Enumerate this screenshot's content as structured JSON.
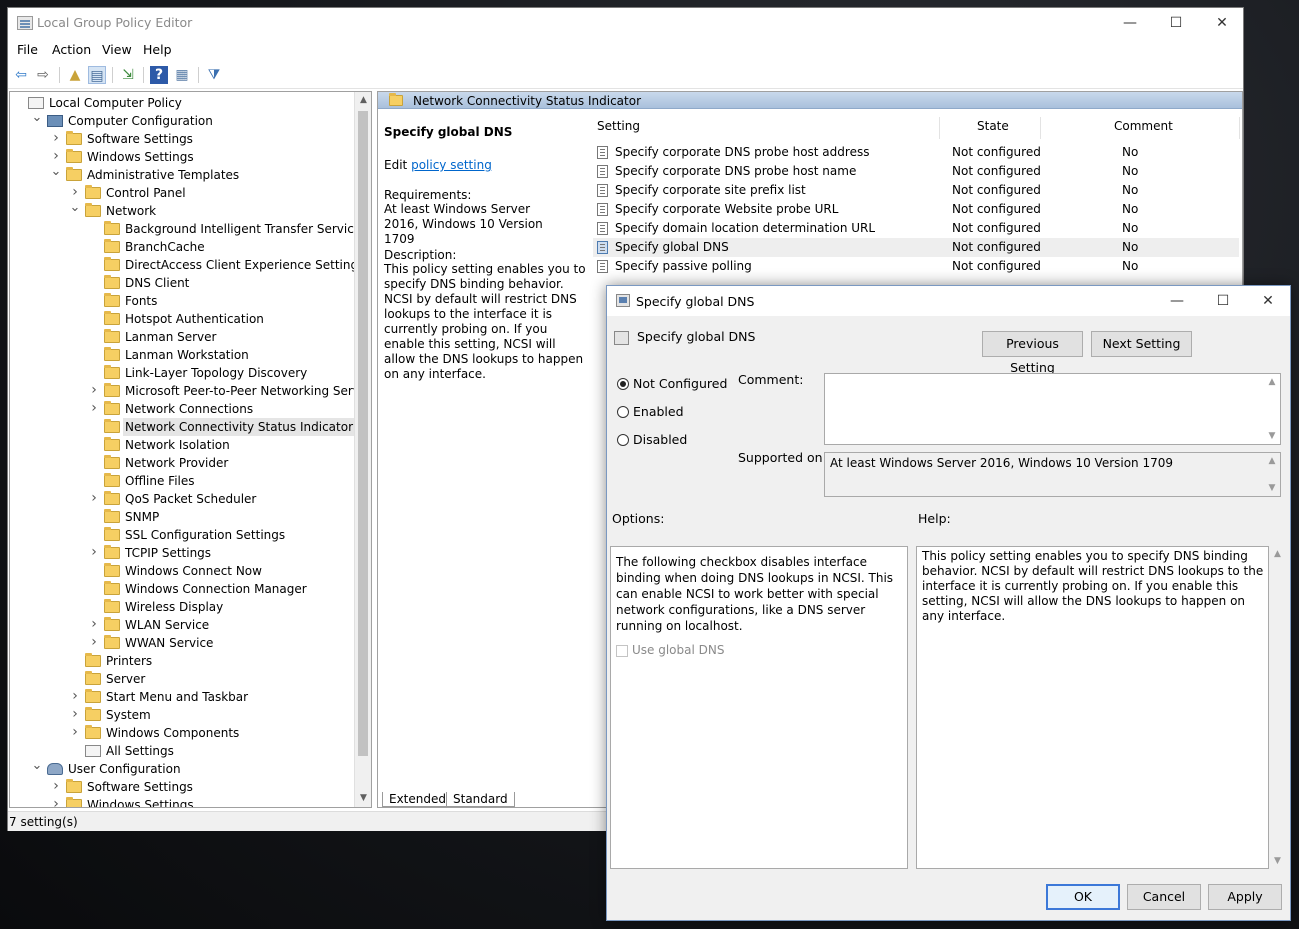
{
  "main_window": {
    "title": "Local Group Policy Editor",
    "min_glyph": "—",
    "max_glyph": "☐",
    "close_glyph": "✕"
  },
  "menu": [
    "File",
    "Action",
    "View",
    "Help"
  ],
  "toolbar": {
    "icons": [
      "back-icon",
      "forward-icon",
      "up-folder-icon",
      "show-hide-tree-icon",
      "export-list-icon",
      "help-icon",
      "properties-icon",
      "filter-icon"
    ],
    "glyphs": [
      "⇦",
      "⇨",
      "▲",
      "▤",
      "⇲",
      "?",
      "▦",
      "⧩"
    ]
  },
  "tree": [
    {
      "label": "Local Computer Policy",
      "level": 0,
      "exp": "",
      "icon": "doc"
    },
    {
      "label": "Computer Configuration",
      "level": 1,
      "exp": "v",
      "icon": "computer"
    },
    {
      "label": "Software Settings",
      "level": 2,
      "exp": ">",
      "icon": "folder"
    },
    {
      "label": "Windows Settings",
      "level": 2,
      "exp": ">",
      "icon": "folder"
    },
    {
      "label": "Administrative Templates",
      "level": 2,
      "exp": "v",
      "icon": "folder"
    },
    {
      "label": "Control Panel",
      "level": 3,
      "exp": ">",
      "icon": "folder"
    },
    {
      "label": "Network",
      "level": 3,
      "exp": "v",
      "icon": "folder"
    },
    {
      "label": "Background Intelligent Transfer Service (BITS)",
      "level": 4,
      "exp": "",
      "icon": "folder"
    },
    {
      "label": "BranchCache",
      "level": 4,
      "exp": "",
      "icon": "folder"
    },
    {
      "label": "DirectAccess Client Experience Settings",
      "level": 4,
      "exp": "",
      "icon": "folder"
    },
    {
      "label": "DNS Client",
      "level": 4,
      "exp": "",
      "icon": "folder"
    },
    {
      "label": "Fonts",
      "level": 4,
      "exp": "",
      "icon": "folder"
    },
    {
      "label": "Hotspot Authentication",
      "level": 4,
      "exp": "",
      "icon": "folder"
    },
    {
      "label": "Lanman Server",
      "level": 4,
      "exp": "",
      "icon": "folder"
    },
    {
      "label": "Lanman Workstation",
      "level": 4,
      "exp": "",
      "icon": "folder"
    },
    {
      "label": "Link-Layer Topology Discovery",
      "level": 4,
      "exp": "",
      "icon": "folder"
    },
    {
      "label": "Microsoft Peer-to-Peer Networking Services",
      "level": 4,
      "exp": ">",
      "icon": "folder"
    },
    {
      "label": "Network Connections",
      "level": 4,
      "exp": ">",
      "icon": "folder"
    },
    {
      "label": "Network Connectivity Status Indicator",
      "level": 4,
      "exp": "",
      "icon": "folder",
      "selected": true
    },
    {
      "label": "Network Isolation",
      "level": 4,
      "exp": "",
      "icon": "folder"
    },
    {
      "label": "Network Provider",
      "level": 4,
      "exp": "",
      "icon": "folder"
    },
    {
      "label": "Offline Files",
      "level": 4,
      "exp": "",
      "icon": "folder"
    },
    {
      "label": "QoS Packet Scheduler",
      "level": 4,
      "exp": ">",
      "icon": "folder"
    },
    {
      "label": "SNMP",
      "level": 4,
      "exp": "",
      "icon": "folder"
    },
    {
      "label": "SSL Configuration Settings",
      "level": 4,
      "exp": "",
      "icon": "folder"
    },
    {
      "label": "TCPIP Settings",
      "level": 4,
      "exp": ">",
      "icon": "folder"
    },
    {
      "label": "Windows Connect Now",
      "level": 4,
      "exp": "",
      "icon": "folder"
    },
    {
      "label": "Windows Connection Manager",
      "level": 4,
      "exp": "",
      "icon": "folder"
    },
    {
      "label": "Wireless Display",
      "level": 4,
      "exp": "",
      "icon": "folder"
    },
    {
      "label": "WLAN Service",
      "level": 4,
      "exp": ">",
      "icon": "folder"
    },
    {
      "label": "WWAN Service",
      "level": 4,
      "exp": ">",
      "icon": "folder"
    },
    {
      "label": "Printers",
      "level": 3,
      "exp": "",
      "icon": "folder"
    },
    {
      "label": "Server",
      "level": 3,
      "exp": "",
      "icon": "folder"
    },
    {
      "label": "Start Menu and Taskbar",
      "level": 3,
      "exp": ">",
      "icon": "folder"
    },
    {
      "label": "System",
      "level": 3,
      "exp": ">",
      "icon": "folder"
    },
    {
      "label": "Windows Components",
      "level": 3,
      "exp": ">",
      "icon": "folder"
    },
    {
      "label": "All Settings",
      "level": 3,
      "exp": "",
      "icon": "doc"
    },
    {
      "label": "User Configuration",
      "level": 1,
      "exp": "v",
      "icon": "user"
    },
    {
      "label": "Software Settings",
      "level": 2,
      "exp": ">",
      "icon": "folder"
    },
    {
      "label": "Windows Settings",
      "level": 2,
      "exp": ">",
      "icon": "folder"
    }
  ],
  "right_pane": {
    "header": "Network Connectivity Status Indicator",
    "ext_title": "Specify global DNS",
    "edit_prefix": "Edit",
    "edit_link": "policy setting",
    "requirements_label": "Requirements:",
    "requirements_text": "At least Windows Server 2016, Windows 10 Version 1709",
    "description_label": "Description:",
    "description_text": "This policy setting enables you to specify DNS binding behavior. NCSI by default will restrict DNS lookups to the interface it is currently probing on. If you enable this setting, NCSI will allow the DNS lookups to happen on any interface.",
    "columns": [
      "Setting",
      "State",
      "Comment"
    ],
    "rows": [
      {
        "setting": "Specify corporate DNS probe host address",
        "state": "Not configured",
        "comment": "No"
      },
      {
        "setting": "Specify corporate DNS probe host name",
        "state": "Not configured",
        "comment": "No"
      },
      {
        "setting": "Specify corporate site prefix list",
        "state": "Not configured",
        "comment": "No"
      },
      {
        "setting": "Specify corporate Website probe URL",
        "state": "Not configured",
        "comment": "No"
      },
      {
        "setting": "Specify domain location determination URL",
        "state": "Not configured",
        "comment": "No"
      },
      {
        "setting": "Specify global DNS",
        "state": "Not configured",
        "comment": "No",
        "highlight": true
      },
      {
        "setting": "Specify passive polling",
        "state": "Not configured",
        "comment": "No"
      }
    ],
    "tabs": [
      "Extended",
      "Standard"
    ]
  },
  "status_bar": "7 setting(s)",
  "dialog": {
    "title": "Specify global DNS",
    "min_glyph": "—",
    "max_glyph": "☐",
    "close_glyph": "✕",
    "setting_name": "Specify global DNS",
    "prev_button": "Previous Setting",
    "next_button": "Next Setting",
    "radios": [
      {
        "label": "Not Configured",
        "checked": true
      },
      {
        "label": "Enabled",
        "checked": false
      },
      {
        "label": "Disabled",
        "checked": false
      }
    ],
    "comment_label": "Comment:",
    "comment_value": "",
    "supported_label": "Supported on:",
    "supported_value": "At least Windows Server 2016, Windows 10 Version 1709",
    "options_label": "Options:",
    "help_label": "Help:",
    "options_text": "The following checkbox disables interface binding when doing DNS lookups in NCSI.   This can enable NCSI to work better with special network configurations, like a DNS server running on localhost.",
    "checkbox_label": "Use global DNS",
    "help_text": "This policy setting enables you to specify DNS binding behavior. NCSI by default will restrict DNS lookups to the interface it is currently probing on. If you enable this setting, NCSI will allow the DNS lookups to happen on any interface.",
    "ok": "OK",
    "cancel": "Cancel",
    "apply": "Apply"
  },
  "colors": {
    "accent": "#3c78d8",
    "link": "#0066cc",
    "header_band": "#b7cbe4"
  }
}
